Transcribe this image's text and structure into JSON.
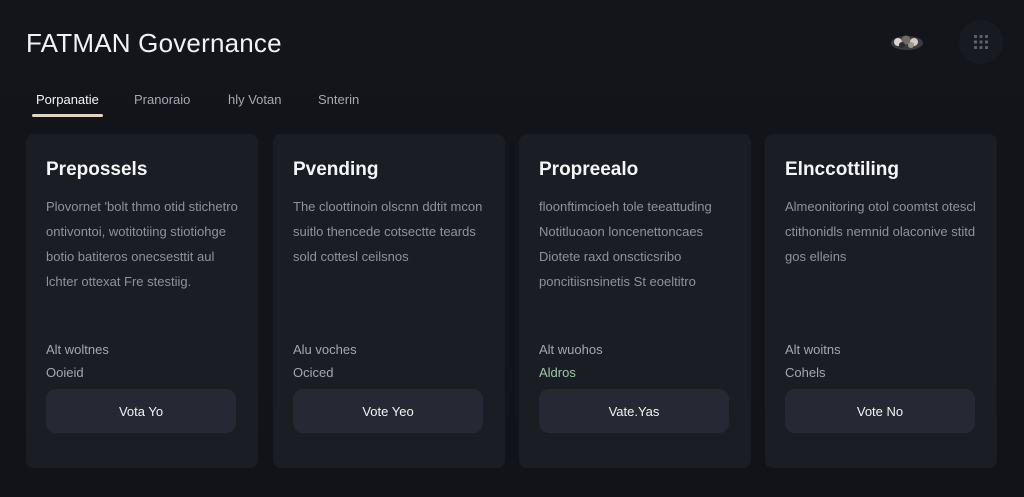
{
  "header": {
    "title": "FATMAN Governance",
    "logo_icon": "fatman-logo-icon",
    "menu_icon": "grid-menu-icon"
  },
  "tabs": [
    {
      "label": "Porpanatie",
      "active": true
    },
    {
      "label": "Pranoraio",
      "active": false
    },
    {
      "label": "hly Votan",
      "active": false
    },
    {
      "label": "Snterin",
      "active": false
    }
  ],
  "cards": [
    {
      "title": "Prepossels",
      "description": "Plovornet 'bolt thmo otid stichetro ontivontoi, wotitotiing stiotiohge botio batiteros onecsesttit aul lchter ottexat Fre stestiig.",
      "votes_label": "Alt woltnes",
      "status": "Ooieid",
      "status_accent": false,
      "button": "Vota Yo"
    },
    {
      "title": "Pvending",
      "description": "The cloottinoin olscnn ddtit mcon suitlo thencede cotsectte teards sold cottesl ceilsnos",
      "votes_label": "Alu voches",
      "status": "Ociced",
      "status_accent": false,
      "button": "Vote Yeo"
    },
    {
      "title": "Propreealo",
      "description": "floonftimcioeh tole teeattuding Notitluoaon loncenettoncaes Diotete raxd onscticsribo poncitiisnsinetis St eoeltitro",
      "votes_label": "Alt wuohos",
      "status": "Aldros",
      "status_accent": true,
      "button": "Vate.Yas"
    },
    {
      "title": "Elnccottiling",
      "description": "Almeonitoring otol coomtst otescl ctithonidls nemnid olaconive stitd gos elleins",
      "votes_label": "Alt woitns",
      "status": "Cohels",
      "status_accent": false,
      "button": "Vote No"
    }
  ]
}
